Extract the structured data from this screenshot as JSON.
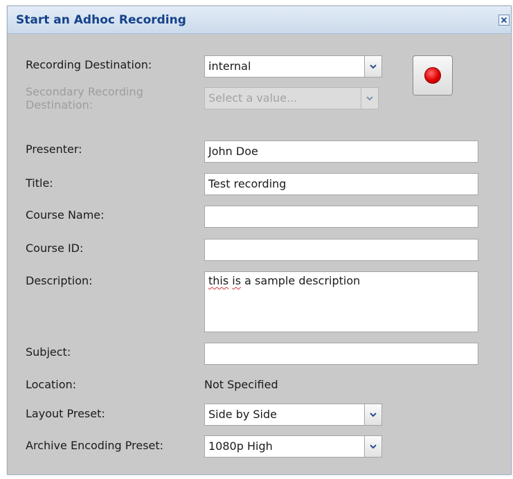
{
  "dialog": {
    "title": "Start an Adhoc Recording"
  },
  "form": {
    "recording_destination": {
      "label": "Recording Destination:",
      "value": "internal"
    },
    "secondary_destination": {
      "label": "Secondary Recording Destination:",
      "placeholder": "Select a value..."
    },
    "presenter": {
      "label": "Presenter:",
      "value": "John Doe"
    },
    "title": {
      "label": "Title:",
      "value": "Test recording"
    },
    "course_name": {
      "label": "Course Name:",
      "value": ""
    },
    "course_id": {
      "label": "Course ID:",
      "value": ""
    },
    "description": {
      "label": "Description:",
      "value_misspelled": "this",
      "value_word2": "is",
      "value_rest": " a sample description"
    },
    "subject": {
      "label": "Subject:",
      "value": ""
    },
    "location": {
      "label": "Location:",
      "value": "Not Specified"
    },
    "layout_preset": {
      "label": "Layout Preset:",
      "value": "Side by Side"
    },
    "archive_preset": {
      "label": "Archive Encoding Preset:",
      "value": "1080p High"
    }
  },
  "icons": {
    "record": "record-icon",
    "close": "close-icon",
    "dropdown": "chevron-down-icon"
  },
  "colors": {
    "title_text": "#15428b",
    "record_red": "#e00000",
    "dialog_bg": "#c9c9c9"
  }
}
